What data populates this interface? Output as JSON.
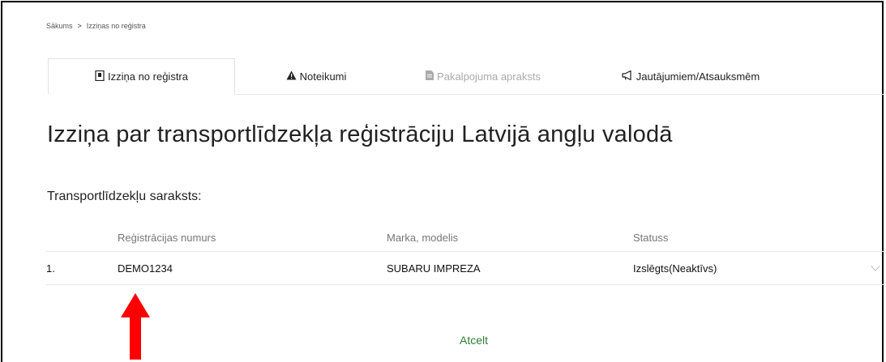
{
  "breadcrumb": {
    "home": "Sākums",
    "separator": ">",
    "current": "Izziņas no reģistra"
  },
  "tabs": [
    {
      "label": "Izziņa no reģistra",
      "icon": "document-icon",
      "active": true,
      "disabled": false
    },
    {
      "label": "Noteikumi",
      "icon": "warning-icon",
      "active": false,
      "disabled": false
    },
    {
      "label": "Pakalpojuma apraksts",
      "icon": "file-icon",
      "active": false,
      "disabled": true
    },
    {
      "label": "Jautājumiem/Atsauksmēm",
      "icon": "megaphone-icon",
      "active": false,
      "disabled": false
    }
  ],
  "page_title": "Izziņa par transportlīdzekļa reģistrāciju Latvijā angļu valodā",
  "list_title": "Transportlīdzekļu saraksts:",
  "table": {
    "headers": [
      "Reģistrācijas numurs",
      "Marka, modelis",
      "Statuss"
    ],
    "rows": [
      {
        "index": "1.",
        "reg_number": "DEMO1234",
        "model": "SUBARU IMPREZA",
        "status": "Izslēgts(Neaktīvs)"
      }
    ]
  },
  "cancel_label": "Atcelt",
  "colors": {
    "accent_green": "#2e7d32",
    "annotation_arrow": "#ff0000"
  }
}
